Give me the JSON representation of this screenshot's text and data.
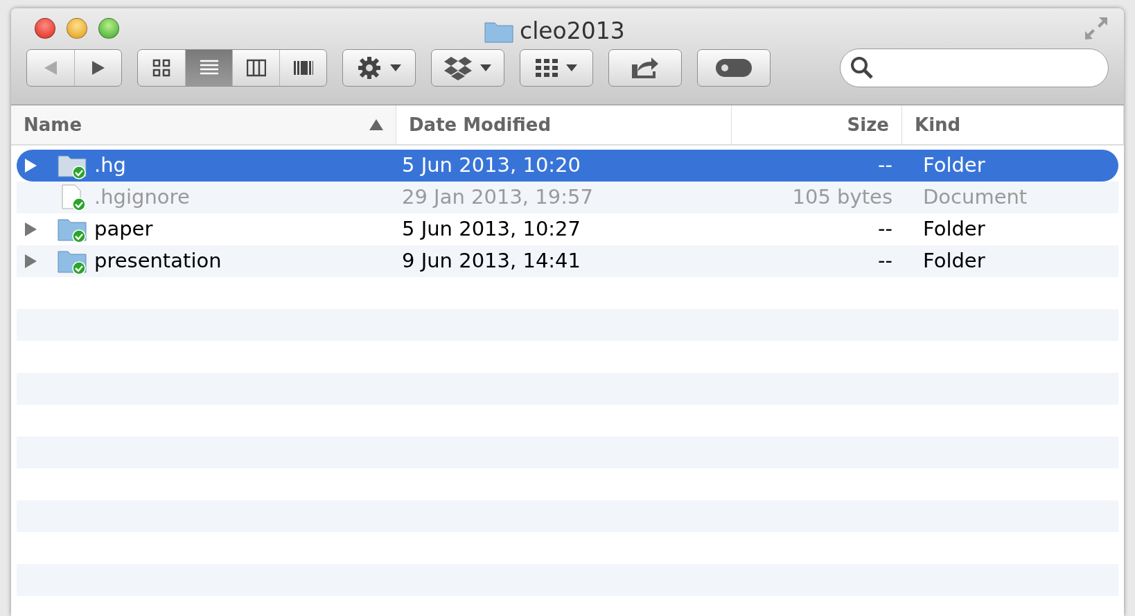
{
  "window": {
    "title": "cleo2013"
  },
  "view_modes": [
    {
      "kind": "icons",
      "selected": false
    },
    {
      "kind": "list",
      "selected": true
    },
    {
      "kind": "columns",
      "selected": false
    },
    {
      "kind": "coverflow",
      "selected": false
    }
  ],
  "table": {
    "columns": [
      {
        "label": "Name",
        "sorted": true
      },
      {
        "label": "Date Modified",
        "sorted": false
      },
      {
        "label": "Size",
        "sorted": false
      },
      {
        "label": "Kind",
        "sorted": false
      }
    ],
    "rows": [
      {
        "kind": "folder",
        "name": ".hg",
        "date": "5 Jun 2013, 10:20",
        "size": "--",
        "type": "Folder",
        "selected": true,
        "dimmed": false
      },
      {
        "kind": "document",
        "name": ".hgignore",
        "date": "29 Jan 2013, 19:57",
        "size": "105 bytes",
        "type": "Document",
        "selected": false,
        "dimmed": true
      },
      {
        "kind": "folder",
        "name": "paper",
        "date": "5 Jun 2013, 10:27",
        "size": "--",
        "type": "Folder",
        "selected": false,
        "dimmed": false
      },
      {
        "kind": "folder",
        "name": "presentation",
        "date": "9 Jun 2013, 14:41",
        "size": "--",
        "type": "Folder",
        "selected": false,
        "dimmed": false
      }
    ]
  }
}
